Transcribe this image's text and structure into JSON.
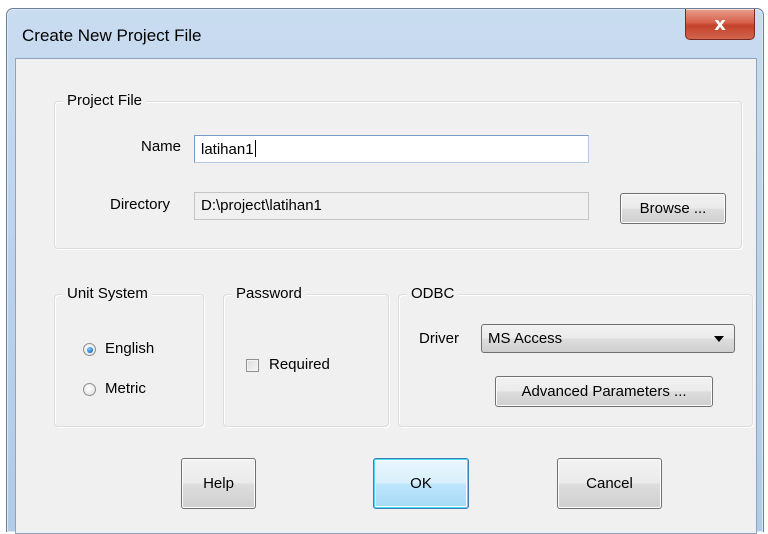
{
  "window": {
    "title": "Create New Project File",
    "close_glyph": "x"
  },
  "project_file": {
    "legend": "Project File",
    "name_label": "Name",
    "name_value": "latihan1",
    "directory_label": "Directory",
    "directory_value": "D:\\project\\latihan1",
    "browse_label": "Browse ..."
  },
  "unit_system": {
    "legend": "Unit System",
    "options": [
      {
        "label": "English",
        "selected": true
      },
      {
        "label": "Metric",
        "selected": false
      }
    ]
  },
  "password": {
    "legend": "Password",
    "required_label": "Required",
    "required_checked": false
  },
  "odbc": {
    "legend": "ODBC",
    "driver_label": "Driver",
    "driver_value": "MS Access",
    "advanced_label": "Advanced Parameters ..."
  },
  "buttons": {
    "help": "Help",
    "ok": "OK",
    "cancel": "Cancel"
  },
  "icons": {
    "close": "close-icon",
    "dropdown": "chevron-down-icon"
  },
  "colors": {
    "title_bar": "#b9d0ea",
    "close_button": "#c94a33",
    "dialog_face": "#f0f0f0",
    "default_button_border": "#3c7fb1"
  }
}
